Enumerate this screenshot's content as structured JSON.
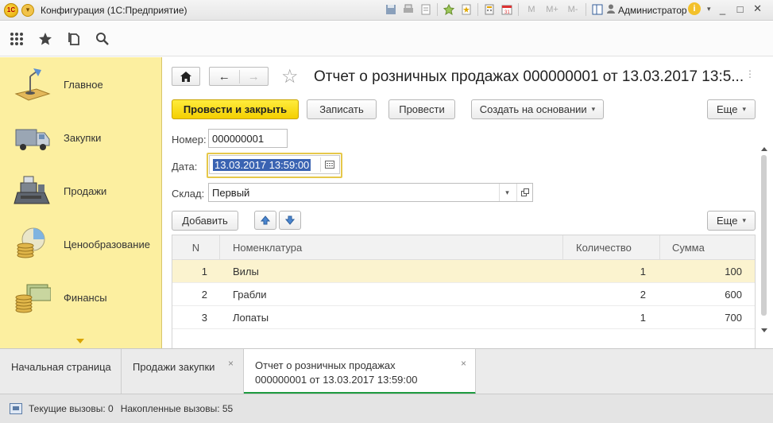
{
  "window": {
    "title": "Конфигурация (1С:Предприятие)",
    "user": "Администратор",
    "m_buttons": [
      "M",
      "M+",
      "M-"
    ],
    "logo_text": "1С",
    "menu_caret": "▾",
    "window_controls": [
      "_",
      "□",
      "✕"
    ]
  },
  "toolbar_icons": [
    "apps-grid-icon",
    "favorites-star-icon",
    "history-icon",
    "search-icon"
  ],
  "sidebar": {
    "items": [
      {
        "label": "Главное",
        "icon": "desk-lamp-icon"
      },
      {
        "label": "Закупки",
        "icon": "truck-icon"
      },
      {
        "label": "Продажи",
        "icon": "cash-register-icon"
      },
      {
        "label": "Ценообразование",
        "icon": "coins-chart-icon"
      },
      {
        "label": "Финансы",
        "icon": "money-coins-icon"
      }
    ]
  },
  "form": {
    "title": "Отчет о розничных продажах 000000001 от 13.03.2017 13:5...",
    "nav": {
      "home": "⌂",
      "back": "←",
      "forward": "→"
    },
    "buttons": {
      "post_and_close": "Провести и закрыть",
      "save": "Записать",
      "post": "Провести",
      "create_based_on": "Создать на основании",
      "more": "Еще",
      "add": "Добавить",
      "table_more": "Еще"
    },
    "fields": {
      "number_label": "Номер:",
      "number_value": "000000001",
      "date_label": "Дата:",
      "date_value": "13.03.2017 13:59:00",
      "warehouse_label": "Склад:",
      "warehouse_value": "Первый"
    },
    "table": {
      "columns": [
        "N",
        "Номенклатура",
        "Количество",
        "Сумма"
      ],
      "rows": [
        {
          "n": "1",
          "item": "Вилы",
          "qty": "1",
          "sum": "100"
        },
        {
          "n": "2",
          "item": "Грабли",
          "qty": "2",
          "sum": "600"
        },
        {
          "n": "3",
          "item": "Лопаты",
          "qty": "1",
          "sum": "700"
        }
      ],
      "selected_row": 0
    }
  },
  "tabs": [
    {
      "label": "Начальная страница"
    },
    {
      "label": "Продажи закупки"
    },
    {
      "label": "Отчет о розничных продажах 000000001 от 13.03.2017 13:59:00"
    }
  ],
  "statusbar": {
    "current_calls": "Текущие вызовы: 0",
    "accumulated_calls": "Накопленные вызовы: 55"
  },
  "colors": {
    "sidebar_bg": "#fcefa0",
    "primary_button": "#f4cf00",
    "active_tab_underline": "#1e9b40",
    "selection": "#3a63b2",
    "selected_row": "#fbf3cf"
  }
}
